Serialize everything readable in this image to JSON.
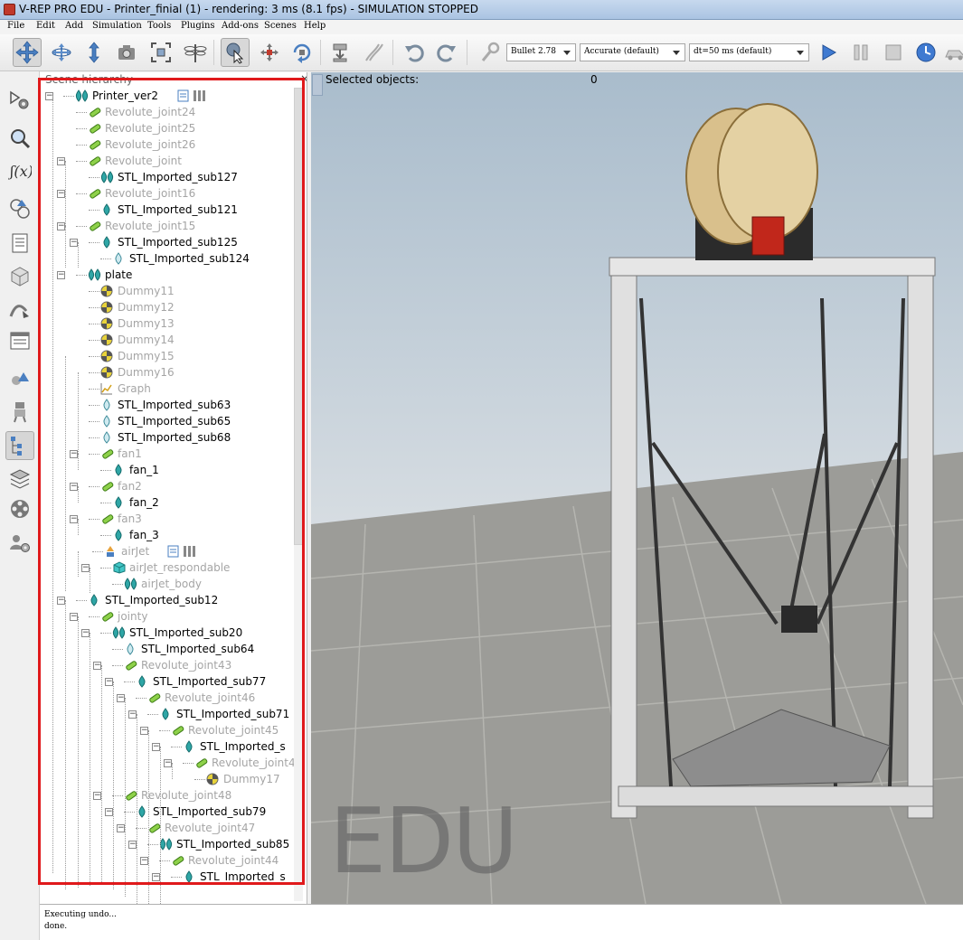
{
  "window": {
    "title": "V-REP PRO EDU - Printer_finial (1) - rendering: 3 ms (8.1 fps) - SIMULATION STOPPED"
  },
  "menu": [
    "File",
    "Edit",
    "Add",
    "Simulation",
    "Tools",
    "Plugins",
    "Add-ons",
    "Scenes",
    "Help"
  ],
  "toolbar": {
    "engine": "Bullet 2.78",
    "accuracy": "Accurate (default)",
    "timestep": "dt=50 ms (default)"
  },
  "hierarchy": {
    "title": "Scene hierarchy",
    "close": "×",
    "rows": [
      {
        "label": "Printer_ver2",
        "icon": "shape-group-icon",
        "dim": false,
        "extra": "script-icons"
      },
      {
        "label": "Revolute_joint24",
        "icon": "joint-icon",
        "dim": true
      },
      {
        "label": "Revolute_joint25",
        "icon": "joint-icon",
        "dim": true
      },
      {
        "label": "Revolute_joint26",
        "icon": "joint-icon",
        "dim": true
      },
      {
        "label": "Revolute_joint",
        "icon": "joint-icon",
        "dim": true
      },
      {
        "label": "STL_Imported_sub127",
        "icon": "shape-group-icon",
        "dim": false
      },
      {
        "label": "Revolute_joint16",
        "icon": "joint-icon",
        "dim": true
      },
      {
        "label": "STL_Imported_sub121",
        "icon": "shape-icon",
        "dim": false
      },
      {
        "label": "Revolute_joint15",
        "icon": "joint-icon",
        "dim": true
      },
      {
        "label": "STL_Imported_sub125",
        "icon": "shape-icon",
        "dim": false
      },
      {
        "label": "STL_Imported_sub124",
        "icon": "shape-outline-icon",
        "dim": false
      },
      {
        "label": "plate",
        "icon": "shape-group-icon",
        "dim": false
      },
      {
        "label": "Dummy11",
        "icon": "dummy-icon",
        "dim": true
      },
      {
        "label": "Dummy12",
        "icon": "dummy-icon",
        "dim": true
      },
      {
        "label": "Dummy13",
        "icon": "dummy-icon",
        "dim": true
      },
      {
        "label": "Dummy14",
        "icon": "dummy-icon",
        "dim": true
      },
      {
        "label": "Dummy15",
        "icon": "dummy-icon",
        "dim": true
      },
      {
        "label": "Dummy16",
        "icon": "dummy-icon",
        "dim": true
      },
      {
        "label": "Graph",
        "icon": "graph-icon",
        "dim": true
      },
      {
        "label": "STL_Imported_sub63",
        "icon": "shape-outline-icon",
        "dim": false
      },
      {
        "label": "STL_Imported_sub65",
        "icon": "shape-outline-icon",
        "dim": false
      },
      {
        "label": "STL_Imported_sub68",
        "icon": "shape-outline-icon",
        "dim": false
      },
      {
        "label": "fan1",
        "icon": "joint-icon",
        "dim": true
      },
      {
        "label": "fan_1",
        "icon": "shape-icon",
        "dim": false
      },
      {
        "label": "fan2",
        "icon": "joint-icon",
        "dim": true
      },
      {
        "label": "fan_2",
        "icon": "shape-icon",
        "dim": false
      },
      {
        "label": "fan3",
        "icon": "joint-icon",
        "dim": true
      },
      {
        "label": "fan_3",
        "icon": "shape-icon",
        "dim": false
      },
      {
        "label": "airJet",
        "icon": "model-icon",
        "dim": true,
        "extra": "script-icons"
      },
      {
        "label": "airJet_respondable",
        "icon": "cube-icon",
        "dim": true
      },
      {
        "label": "airJet_body",
        "icon": "shape-group-icon",
        "dim": true
      },
      {
        "label": "STL_Imported_sub12",
        "icon": "shape-icon",
        "dim": false
      },
      {
        "label": "jointy",
        "icon": "joint-icon",
        "dim": true
      },
      {
        "label": "STL_Imported_sub20",
        "icon": "shape-group-icon",
        "dim": false
      },
      {
        "label": "STL_Imported_sub64",
        "icon": "shape-outline-icon",
        "dim": false
      },
      {
        "label": "Revolute_joint43",
        "icon": "joint-icon",
        "dim": true
      },
      {
        "label": "STL_Imported_sub77",
        "icon": "shape-icon",
        "dim": false
      },
      {
        "label": "Revolute_joint46",
        "icon": "joint-icon",
        "dim": true
      },
      {
        "label": "STL_Imported_sub71",
        "icon": "shape-icon",
        "dim": false
      },
      {
        "label": "Revolute_joint45",
        "icon": "joint-icon",
        "dim": true
      },
      {
        "label": "STL_Imported_s",
        "icon": "shape-icon",
        "dim": false
      },
      {
        "label": "Revolute_joint4",
        "icon": "joint-icon",
        "dim": true
      },
      {
        "label": "Dummy17",
        "icon": "dummy-icon",
        "dim": true
      },
      {
        "label": "Revolute_joint48",
        "icon": "joint-icon",
        "dim": true
      },
      {
        "label": "STL_Imported_sub79",
        "icon": "shape-icon",
        "dim": false
      },
      {
        "label": "Revolute_joint47",
        "icon": "joint-icon",
        "dim": true
      },
      {
        "label": "STL_Imported_sub85",
        "icon": "shape-group-icon",
        "dim": false
      },
      {
        "label": "Revolute_joint44",
        "icon": "joint-icon",
        "dim": true
      },
      {
        "label": "STL_Imported_s",
        "icon": "shape-icon",
        "dim": false
      }
    ]
  },
  "viewport": {
    "selected_label": "Selected objects:",
    "selected_count": "0",
    "watermark": "EDU"
  },
  "console": {
    "lines": [
      "Executing undo...",
      "done."
    ]
  },
  "colors": {
    "highlight_box": "#e0191b",
    "dim_text": "#a5a5a5"
  }
}
